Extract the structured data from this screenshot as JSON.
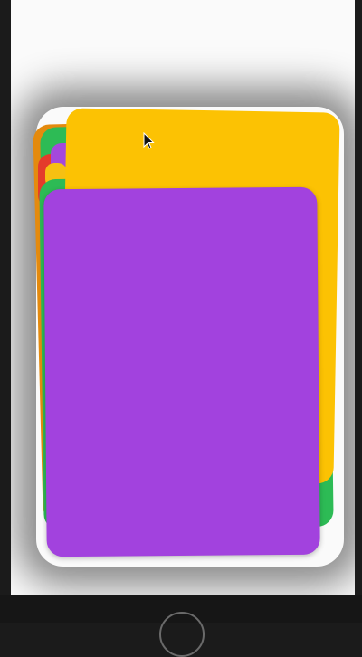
{
  "app": {
    "screen_background": "#fafafa",
    "frame_color": "#1b1b1b"
  },
  "cards": [
    {
      "name": "card-back-orange",
      "color": "#e48a0e"
    },
    {
      "name": "card-back-green",
      "color": "#2dbb55"
    },
    {
      "name": "card-back-red",
      "color": "#e43b2b"
    },
    {
      "name": "card-back-purple-small",
      "color": "#a448dc"
    },
    {
      "name": "card-back-yellow-small",
      "color": "#f6c012"
    },
    {
      "name": "card-back-green-2",
      "color": "#2dbb55"
    },
    {
      "name": "card-yellow",
      "color": "#fcc203"
    },
    {
      "name": "card-purple-front",
      "color": "#a242de"
    }
  ],
  "icons": {
    "cursor": "mouse-pointer-icon",
    "home": "home-button-icon"
  }
}
